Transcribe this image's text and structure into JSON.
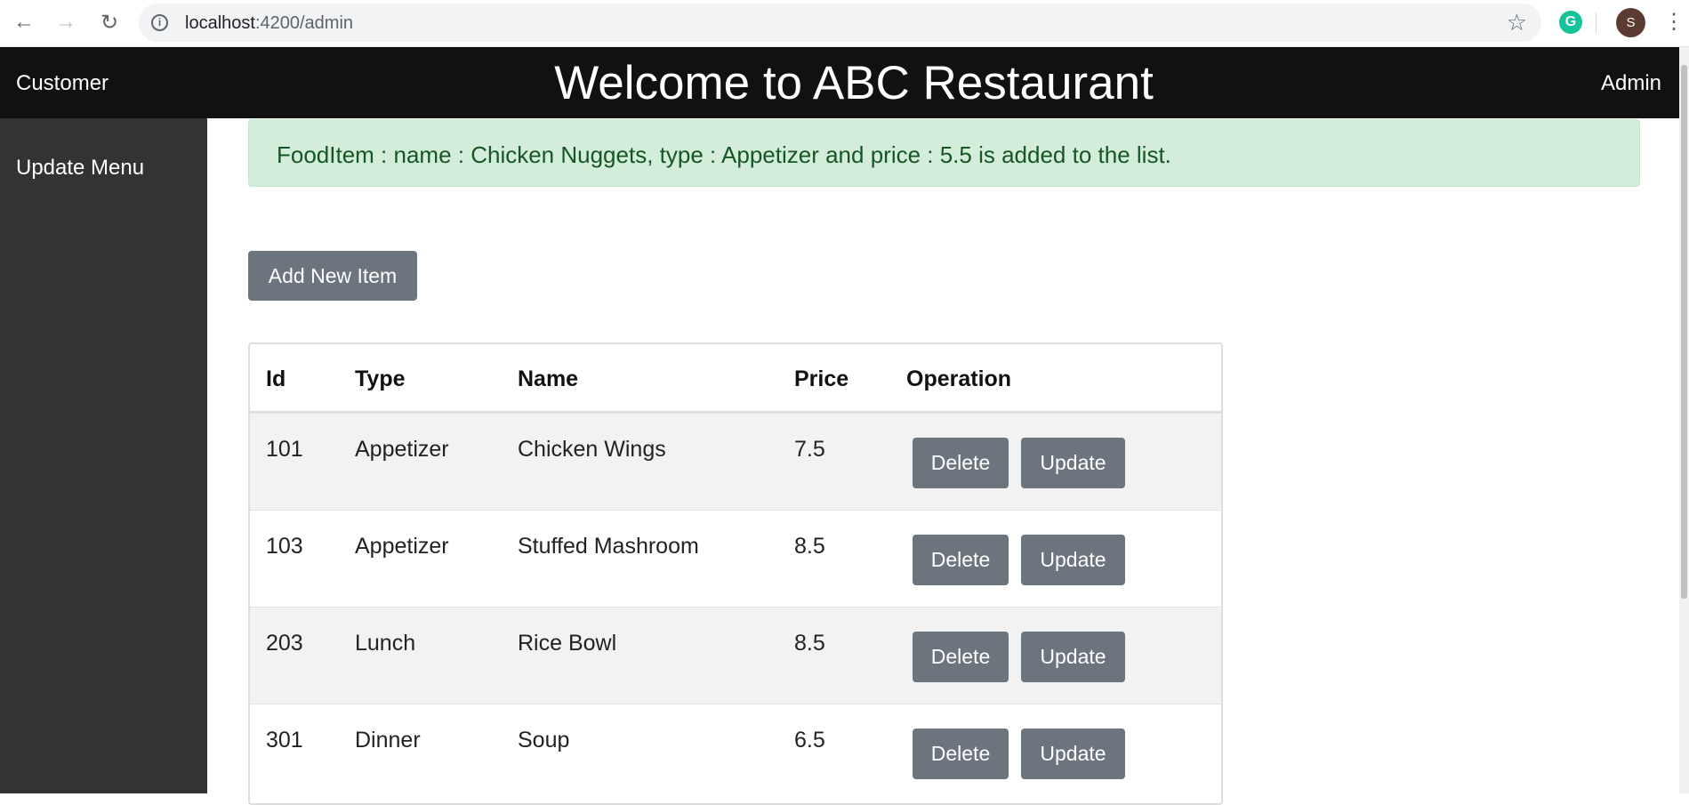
{
  "browser": {
    "url_host": "localhost",
    "url_path": ":4200/admin",
    "profile_initial": "S",
    "extension_letter": "G"
  },
  "nav": {
    "customer": "Customer",
    "title": "Welcome to ABC Restaurant",
    "admin": "Admin"
  },
  "sidebar": {
    "items": [
      {
        "label": "Update Menu"
      }
    ]
  },
  "alert": {
    "message": "FoodItem : name : Chicken Nuggets, type : Appetizer and price : 5.5 is added to the list."
  },
  "actions": {
    "add_new_item": "Add New Item"
  },
  "table": {
    "headers": {
      "id": "Id",
      "type": "Type",
      "name": "Name",
      "price": "Price",
      "operation": "Operation"
    },
    "rows": [
      {
        "id": "101",
        "type": "Appetizer",
        "name": "Chicken Wings",
        "price": "7.5",
        "delete": "Delete",
        "update": "Update"
      },
      {
        "id": "103",
        "type": "Appetizer",
        "name": "Stuffed Mashroom",
        "price": "8.5",
        "delete": "Delete",
        "update": "Update"
      },
      {
        "id": "203",
        "type": "Lunch",
        "name": "Rice Bowl",
        "price": "8.5",
        "delete": "Delete",
        "update": "Update"
      },
      {
        "id": "301",
        "type": "Dinner",
        "name": "Soup",
        "price": "6.5",
        "delete": "Delete",
        "update": "Update"
      }
    ]
  }
}
